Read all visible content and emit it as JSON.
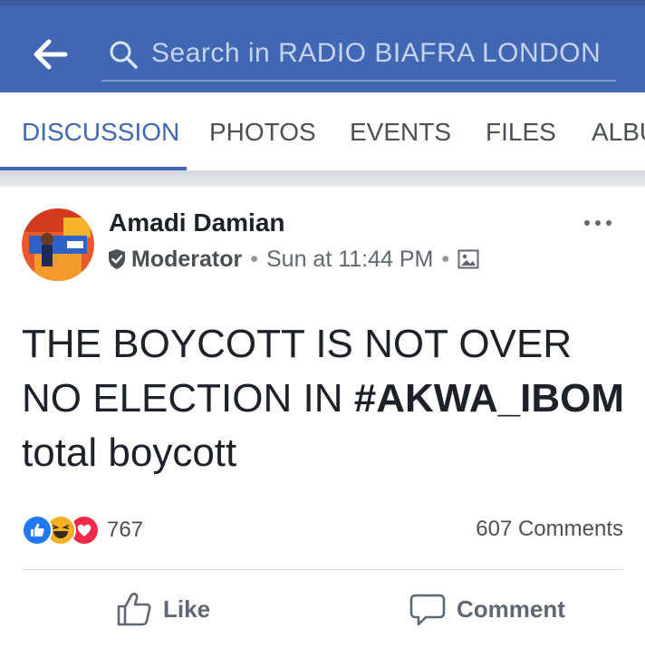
{
  "header": {
    "back_icon": "back-arrow-icon",
    "search_icon": "search-icon",
    "search_placeholder": "Search in RADIO BIAFRA LONDON",
    "bg_color": "#4267b2"
  },
  "tabs": [
    {
      "label": "DISCUSSION",
      "active": true
    },
    {
      "label": "PHOTOS",
      "active": false
    },
    {
      "label": "EVENTS",
      "active": false
    },
    {
      "label": "FILES",
      "active": false
    },
    {
      "label": "ALBU",
      "active": false
    }
  ],
  "post": {
    "author": "Amadi Damian",
    "role": "Moderator",
    "separator": "•",
    "timestamp": "Sun at 11:44 PM",
    "privacy_icon": "photo-icon",
    "more_icon": "more-dots-icon",
    "body": {
      "line1": "THE BOYCOTT IS NOT OVER",
      "line2_prefix": "NO ELECTION IN ",
      "hashtag": "#AKWA_IBOM",
      "line3": "total boycott"
    },
    "reactions": [
      "like",
      "haha",
      "love"
    ],
    "reaction_count": "767",
    "comment_count": "607 Comments"
  },
  "actions": {
    "like_label": "Like",
    "comment_label": "Comment"
  },
  "colors": {
    "accent": "#4267b2",
    "like": "#2078f4",
    "haha": "#f7b125",
    "love": "#f0284a"
  }
}
